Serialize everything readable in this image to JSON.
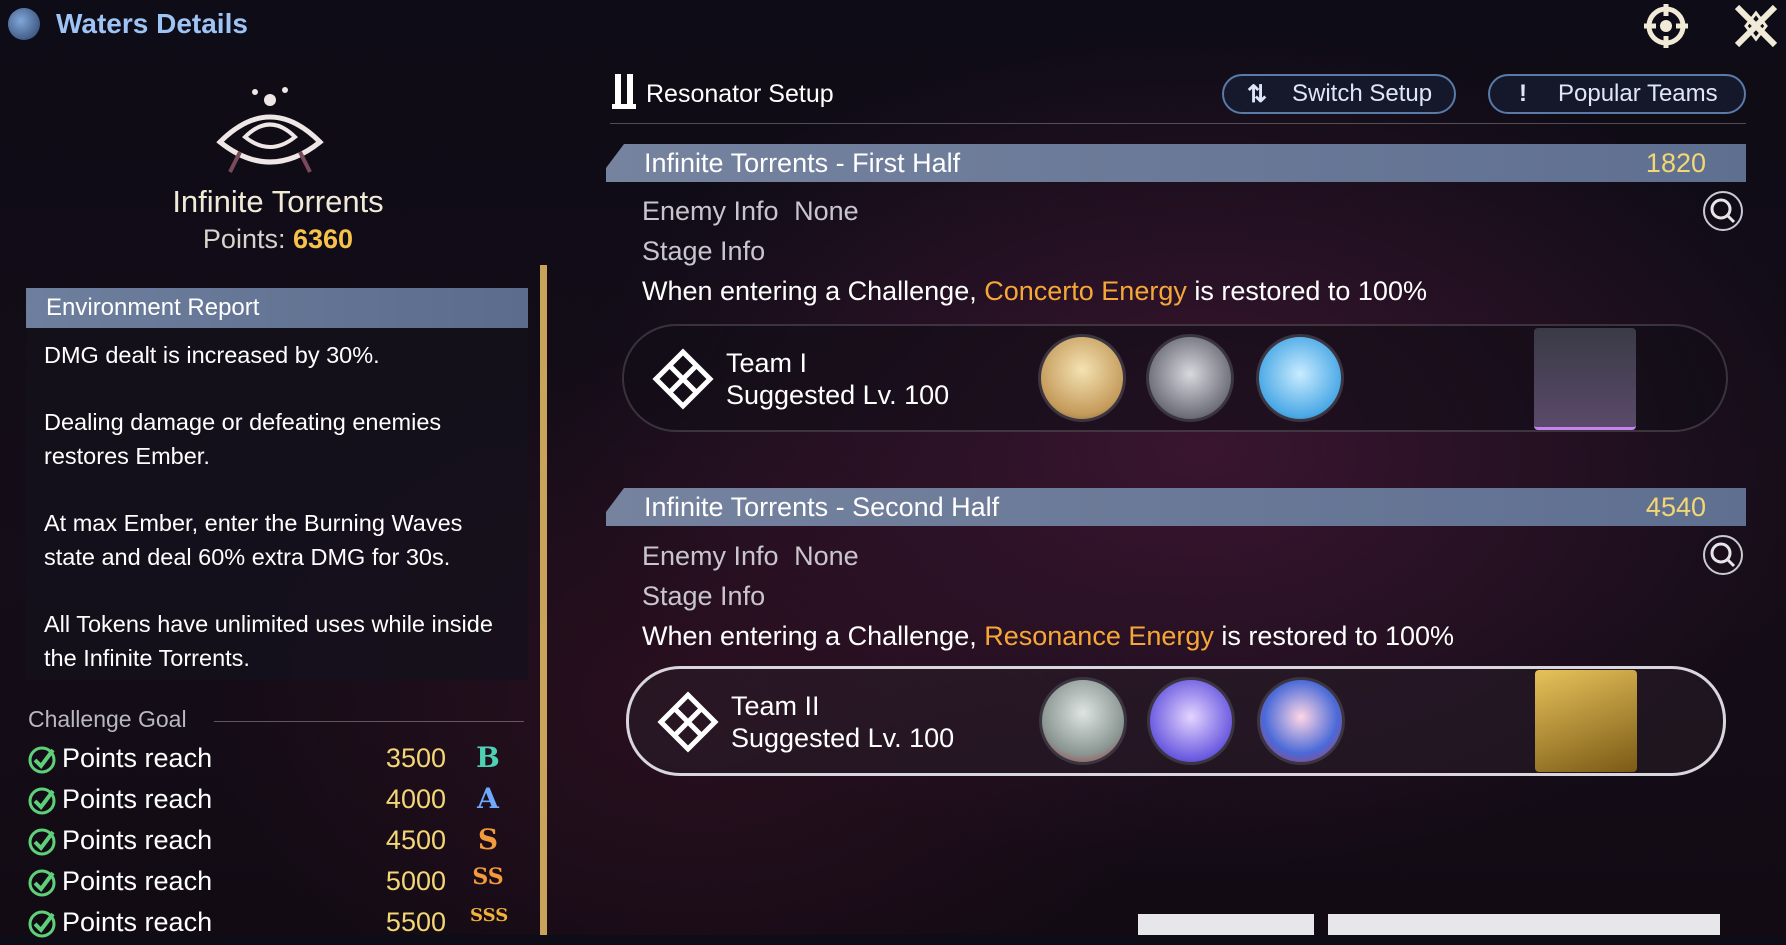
{
  "header": {
    "title": "Waters Details"
  },
  "left": {
    "mode_name": "Infinite Torrents",
    "points_label": "Points:",
    "points_value": "6360",
    "environment_report": {
      "title": "Environment Report",
      "paragraphs": [
        "DMG dealt is increased by 30%.",
        "Dealing damage or defeating enemies restores Ember.",
        "At max Ember, enter the Burning Waves state and deal 60% extra DMG for 30s.",
        "All Tokens have unlimited uses while inside the Infinite Torrents."
      ]
    },
    "challenge_goal": {
      "title": "Challenge Goal",
      "items": [
        {
          "label": "Points reach",
          "value": "3500",
          "rank": "B",
          "rank_color": "#4fd1b5"
        },
        {
          "label": "Points reach",
          "value": "4000",
          "rank": "A",
          "rank_color": "#6fa8ff"
        },
        {
          "label": "Points reach",
          "value": "4500",
          "rank": "S",
          "rank_color": "#f29a3c"
        },
        {
          "label": "Points reach",
          "value": "5000",
          "rank": "SS",
          "rank_color": "#f29a3c"
        },
        {
          "label": "Points reach",
          "value": "5500",
          "rank": "SSS",
          "rank_color": "#f2b23c"
        }
      ]
    }
  },
  "setup": {
    "title": "Resonator Setup",
    "switch_button": "Switch Setup",
    "switch_icon": "⇅",
    "popular_button": "Popular Teams",
    "popular_icon": "!"
  },
  "halves": [
    {
      "title": "Infinite Torrents - First Half",
      "score": "1820",
      "enemy_label": "Enemy Info",
      "enemy_value": "None",
      "stage_label": "Stage Info",
      "desc_pre": "When entering a Challenge, ",
      "desc_highlight": "Concerto Energy",
      "desc_post": " is restored to 100%",
      "team_name": "Team I",
      "team_level": "Suggested Lv. 100"
    },
    {
      "title": "Infinite Torrents - Second Half",
      "score": "4540",
      "enemy_label": "Enemy Info",
      "enemy_value": "None",
      "stage_label": "Stage Info",
      "desc_pre": "When entering a Challenge, ",
      "desc_highlight": "Resonance Energy",
      "desc_post": " is restored to 100%",
      "team_name": "Team II",
      "team_level": "Suggested Lv. 100"
    }
  ],
  "colors": {
    "accent_gold": "#f3d774",
    "highlight_orange": "#f6a738",
    "title_blue": "#9ec3f5"
  }
}
